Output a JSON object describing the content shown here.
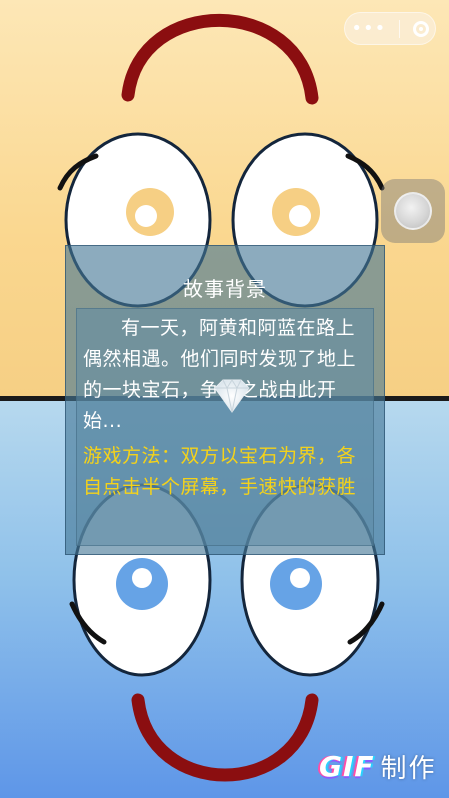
{
  "dialog": {
    "title": "故事背景",
    "story": "有一天，阿黄和阿蓝在路上偶然相遇。他们同时发现了地上的一块宝石，争夺之战由此开始...",
    "method": "游戏方法：双方以宝石为界，各自点击半个屏幕，手速快的获胜"
  },
  "capsule": {
    "more_icon": "more-dots-icon",
    "close_icon": "close-ring-icon"
  },
  "watermark": {
    "brand": "GIF",
    "label": "制作"
  },
  "colors": {
    "top_player": "#fad78f",
    "bottom_player": "#5e96e8",
    "mouth": "#8b0e10",
    "method_text": "#f4d21a"
  }
}
